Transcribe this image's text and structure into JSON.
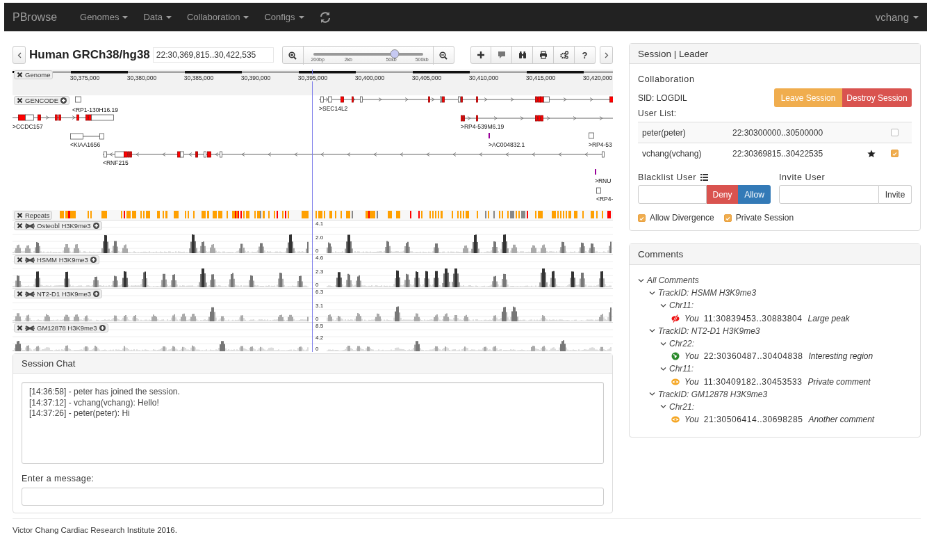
{
  "navbar": {
    "brand": "PBrowse",
    "menus": [
      "Genomes",
      "Data",
      "Collaboration",
      "Configs"
    ],
    "user": "vchang"
  },
  "toolbar": {
    "title": "Human GRCh38/hg38",
    "location": "22:30,369,815..30,422,535",
    "zoom_slider": {
      "level": 0.74,
      "labels": [
        "200bp",
        "2kb",
        "50kb",
        "500kb"
      ]
    },
    "help_button": "?"
  },
  "ruler": {
    "track_label": "Genome",
    "ticks": [
      "30,375,000",
      "30,380,000",
      "30,385,000",
      "30,390,000",
      "30,395,000",
      "30,400,000",
      "30,405,000",
      "30,410,000",
      "30,415,000",
      "30,420,000"
    ]
  },
  "gencode": {
    "track_label": "GENCODE",
    "genes": [
      {
        "label": "<RP1-130H16.19"
      },
      {
        "label": ">CCDC157"
      },
      {
        "label": "<KIAA1656"
      },
      {
        "label": "<RNF215"
      },
      {
        "label": ">SEC14L2"
      },
      {
        "label": ">RP4-539M6.19"
      },
      {
        "label": ">AC004832.1"
      },
      {
        "label": ">RP4-53"
      },
      {
        "label": ">RNU"
      },
      {
        "label": "<RP4-"
      }
    ]
  },
  "repeats": {
    "track_label": "Repeats"
  },
  "signal_tracks": [
    {
      "label": "Osteobl H3K9me3",
      "axis_labels": [
        "4.1",
        "2.0",
        "0"
      ]
    },
    {
      "label": "HSMM H3K9me3",
      "axis_labels": [
        "4.6",
        "2.3",
        "0"
      ]
    },
    {
      "label": "NT2-D1 H3K9me3",
      "axis_labels": [
        "6.3",
        "3.1",
        "0"
      ]
    },
    {
      "label": "GM12878 H3K9me3",
      "axis_labels": [
        "8.5",
        "4.2",
        "0"
      ]
    }
  ],
  "chat": {
    "title": "Session Chat",
    "messages": [
      "[14:36:58] - peter has joined the session.",
      "[14:37:12] - vchang(vchang): Hello!",
      "[14:37:26] - peter(peter): Hi"
    ],
    "input_label": "Enter a message:"
  },
  "session": {
    "title": "Session | Leader",
    "heading": "Collaboration",
    "sid": "SID: LOGDIL",
    "leave_button": "Leave Session",
    "destroy_button": "Destroy Session",
    "user_list_label": "User List:",
    "users": [
      {
        "name": "peter(peter)",
        "region": "22:30300000..30500000",
        "leader": false,
        "checked": false
      },
      {
        "name": "vchang(vchang)",
        "region": "22:30369815..30422535",
        "leader": true,
        "checked": true
      }
    ],
    "blacklist": {
      "label": "Blacklist User",
      "deny_button": "Deny",
      "allow_button": "Allow"
    },
    "invite": {
      "label": "Invite User",
      "button": "Invite"
    },
    "options": [
      {
        "label": "Allow Divergence",
        "checked": true
      },
      {
        "label": "Private Session",
        "checked": true
      }
    ]
  },
  "comments": {
    "title": "Comments",
    "tree": [
      {
        "label": "All Comments",
        "expanded": true,
        "children": [
          {
            "label": "TrackID: HSMM H3K9me3",
            "expanded": true,
            "children": [
              {
                "label": "Chr11:",
                "expanded": true,
                "children": [
                  {
                    "kind": "hidden",
                    "author": "You",
                    "region": "11:30839453..30883804",
                    "text": "Large peak"
                  }
                ]
              }
            ]
          },
          {
            "label": "TrackID: NT2-D1 H3K9me3",
            "expanded": true,
            "children": [
              {
                "label": "Chr22:",
                "expanded": true,
                "children": [
                  {
                    "kind": "public",
                    "author": "You",
                    "region": "22:30360487..30404838",
                    "text": "Interesting region"
                  }
                ]
              },
              {
                "label": "Chr11:",
                "expanded": true,
                "children": [
                  {
                    "kind": "private",
                    "author": "You",
                    "region": "11:30409182..30453533",
                    "text": "Private comment"
                  }
                ]
              }
            ]
          },
          {
            "label": "TrackID: GM12878 H3K9me3",
            "expanded": true,
            "children": [
              {
                "label": "Chr21:",
                "expanded": true,
                "children": [
                  {
                    "kind": "private",
                    "author": "You",
                    "region": "21:30506414..30698285",
                    "text": "Another comment"
                  }
                ]
              }
            ]
          }
        ]
      }
    ]
  },
  "footer": "Victor Chang Cardiac Research Institute 2016."
}
